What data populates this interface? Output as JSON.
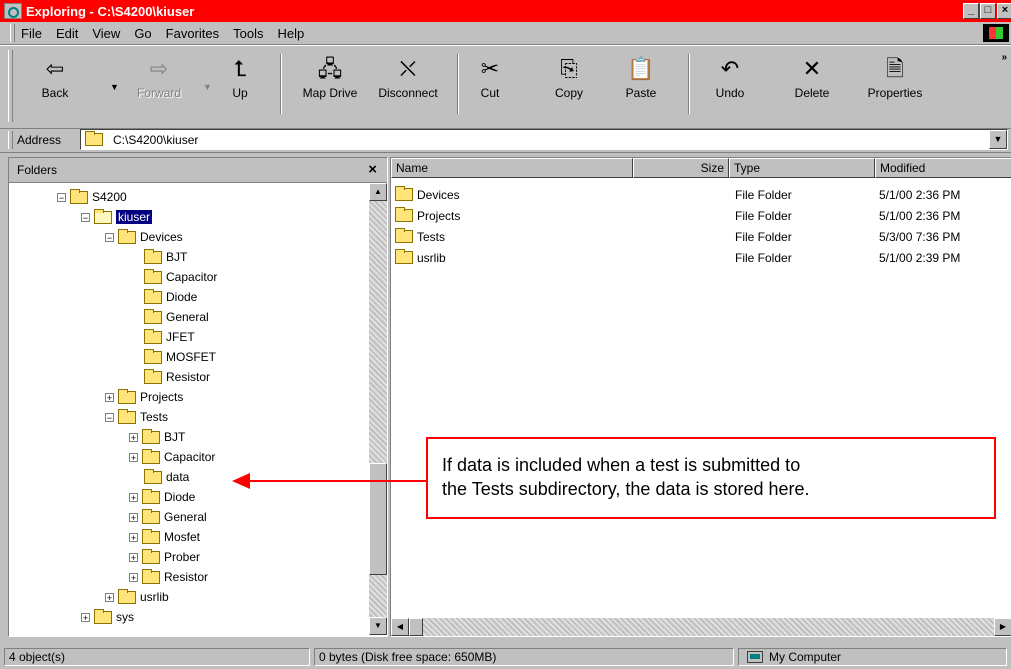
{
  "window": {
    "title": "Exploring - C:\\S4200\\kiuser",
    "min_label": "_",
    "max_label": "□",
    "close_label": "×"
  },
  "menu": [
    "File",
    "Edit",
    "View",
    "Go",
    "Favorites",
    "Tools",
    "Help"
  ],
  "toolbar": {
    "back": "Back",
    "forward": "Forward",
    "up": "Up",
    "map_drive": "Map Drive",
    "disconnect": "Disconnect",
    "cut": "Cut",
    "copy": "Copy",
    "paste": "Paste",
    "undo": "Undo",
    "delete": "Delete",
    "properties": "Properties"
  },
  "address": {
    "label": "Address",
    "value": "C:\\S4200\\kiuser"
  },
  "folders_pane": {
    "title": "Folders",
    "close": "×",
    "tree": [
      {
        "label": "S4200",
        "expander": "−"
      },
      {
        "label": "kiuser",
        "expander": "−"
      },
      {
        "label": "Devices",
        "expander": "−"
      },
      {
        "label": "BJT"
      },
      {
        "label": "Capacitor"
      },
      {
        "label": "Diode"
      },
      {
        "label": "General"
      },
      {
        "label": "JFET"
      },
      {
        "label": "MOSFET"
      },
      {
        "label": "Resistor"
      },
      {
        "label": "Projects",
        "expander": "+"
      },
      {
        "label": "Tests",
        "expander": "−"
      },
      {
        "label": "BJT",
        "expander": "+"
      },
      {
        "label": "Capacitor",
        "expander": "+"
      },
      {
        "label": "data"
      },
      {
        "label": "Diode",
        "expander": "+"
      },
      {
        "label": "General",
        "expander": "+"
      },
      {
        "label": "Mosfet",
        "expander": "+"
      },
      {
        "label": "Prober",
        "expander": "+"
      },
      {
        "label": "Resistor",
        "expander": "+"
      },
      {
        "label": "usrlib",
        "expander": "+"
      },
      {
        "label": "sys",
        "expander": "+"
      }
    ]
  },
  "file_list": {
    "columns": {
      "name": "Name",
      "size": "Size",
      "type": "Type",
      "modified": "Modified"
    },
    "rows": [
      {
        "name": "Devices",
        "type": "File Folder",
        "modified": "5/1/00 2:36 PM"
      },
      {
        "name": "Projects",
        "type": "File Folder",
        "modified": "5/1/00 2:36 PM"
      },
      {
        "name": "Tests",
        "type": "File Folder",
        "modified": "5/3/00 7:36 PM"
      },
      {
        "name": "usrlib",
        "type": "File Folder",
        "modified": "5/1/00 2:39 PM"
      }
    ]
  },
  "callout": {
    "line1": "If data is included when a test is submitted to",
    "line2": "the Tests subdirectory, the data is stored here."
  },
  "status": {
    "objects": "4 object(s)",
    "disk": "0 bytes (Disk free space: 650MB)",
    "location": "My Computer"
  },
  "colors": {
    "title_bar": "#ff0000",
    "callout_border": "#ff0000",
    "chrome": "#c0c0c0"
  }
}
